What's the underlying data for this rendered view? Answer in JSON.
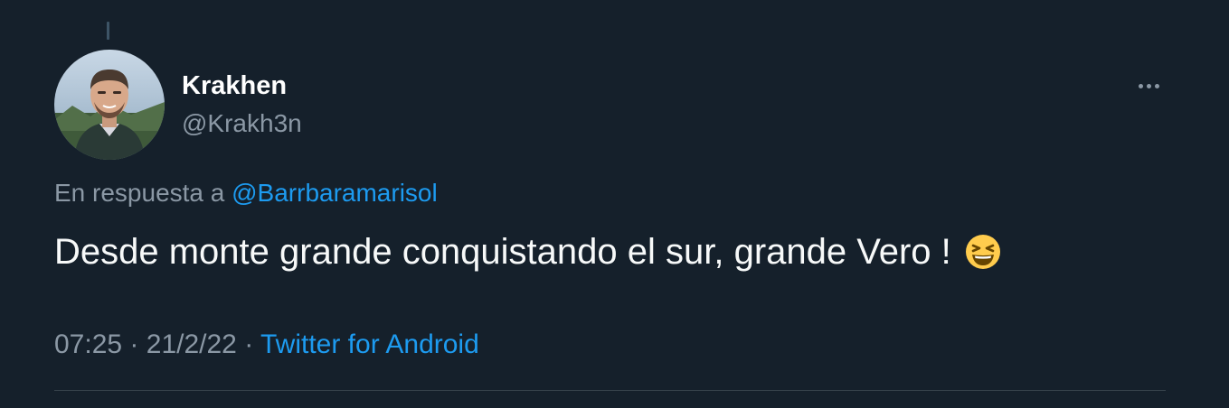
{
  "tweet": {
    "author": {
      "name": "Krakhen",
      "handle": "@Krakh3n",
      "avatar_icon": "user-photo-avatar"
    },
    "more_icon": "more-horizontal-icon",
    "reply_prefix": "En respuesta a",
    "reply_to": "@Barrbaramarisol",
    "text": "Desde monte grande conquistando el sur, grande Vero !",
    "emoji": "grinning-squinting-face-emoji",
    "time": "07:25",
    "separator": "·",
    "date": "21/2/22",
    "source": "Twitter for Android"
  },
  "colors": {
    "background": "#15202b",
    "primary_text": "#f7f9f9",
    "secondary_text": "#8b98a5",
    "link": "#1d9bf0",
    "divider": "#38444d"
  }
}
